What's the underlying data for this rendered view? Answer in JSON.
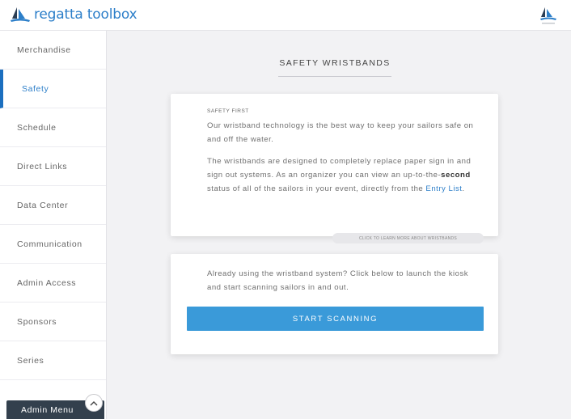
{
  "app": {
    "logo_text": "regatta toolbox",
    "brand_color": "#2d7fc9",
    "corner_icon": "regatta-sail-icon"
  },
  "sidebar": {
    "items": [
      {
        "label": "Merchandise"
      },
      {
        "label": "Safety",
        "active": true
      },
      {
        "label": "Schedule"
      },
      {
        "label": "Direct Links"
      },
      {
        "label": "Data Center"
      },
      {
        "label": "Communication"
      },
      {
        "label": "Admin Access"
      },
      {
        "label": "Sponsors"
      },
      {
        "label": "Series"
      }
    ],
    "admin_menu_label": "Admin Menu",
    "admin_menu_icon": "chevron-up-icon"
  },
  "main": {
    "title": "SAFETY WRISTBANDS",
    "card1": {
      "eyebrow": "SAFETY FIRST",
      "paragraph1": "Our wristband technology is the best way to keep your sailors safe on and off the water.",
      "paragraph2_before": "The wristbands are designed to completely replace paper sign in and sign out systems. As an organizer you can view an up-to-the-",
      "paragraph2_bold": "second",
      "paragraph2_after": " status of all of the sailors in your event, directly from the ",
      "entry_list_link": "Entry List",
      "paragraph2_end": "."
    },
    "learn_more_label": "CLICK TO LEARN MORE ABOUT WRISTBANDS",
    "card2": {
      "paragraph": "Already using the wristband system? Click below to launch the kiosk and start scanning sailors in and out.",
      "button_label": "START SCANNING",
      "button_color": "#3a9ad9"
    }
  }
}
